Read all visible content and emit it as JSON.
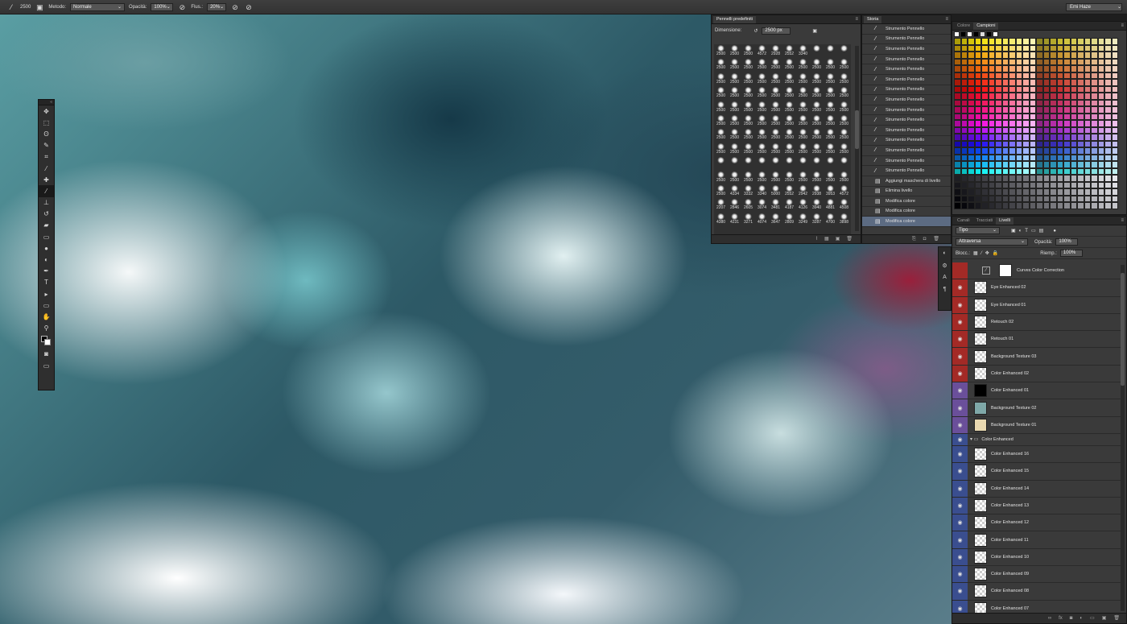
{
  "options_bar": {
    "brush_size": "2500",
    "mode_label": "Metodo:",
    "mode_value": "Normale",
    "opacity_label": "Opacità:",
    "opacity_value": "100%",
    "flow_label": "Flus.:",
    "flow_value": "20%",
    "workspace": "Emi Haze"
  },
  "toolbar": {
    "tools": [
      {
        "name": "move-tool",
        "glyph": "✥"
      },
      {
        "name": "marquee-tool",
        "glyph": "⬚"
      },
      {
        "name": "lasso-tool",
        "glyph": "ʘ"
      },
      {
        "name": "quick-select-tool",
        "glyph": "✎"
      },
      {
        "name": "crop-tool",
        "glyph": "⌗"
      },
      {
        "name": "eyedropper-tool",
        "glyph": "⁄"
      },
      {
        "name": "healing-brush-tool",
        "glyph": "✚"
      },
      {
        "name": "brush-tool",
        "glyph": "⁄"
      },
      {
        "name": "clone-stamp-tool",
        "glyph": "⊥"
      },
      {
        "name": "history-brush-tool",
        "glyph": "↺"
      },
      {
        "name": "eraser-tool",
        "glyph": "▰"
      },
      {
        "name": "gradient-tool",
        "glyph": "▭"
      },
      {
        "name": "blur-tool",
        "glyph": "●"
      },
      {
        "name": "dodge-tool",
        "glyph": "◐"
      },
      {
        "name": "pen-tool",
        "glyph": "✒"
      },
      {
        "name": "type-tool",
        "glyph": "T"
      },
      {
        "name": "path-select-tool",
        "glyph": "▸"
      },
      {
        "name": "shape-tool",
        "glyph": "▭"
      },
      {
        "name": "hand-tool",
        "glyph": "✋"
      },
      {
        "name": "zoom-tool",
        "glyph": "⚲"
      }
    ]
  },
  "brushes_panel": {
    "title": "Pennelli predefiniti",
    "dimension_label": "Dimensione:",
    "dimension_value": "2500 px",
    "sizes": [
      "2500",
      "2500",
      "2500",
      "4572",
      "2928",
      "2552",
      "3340",
      "",
      "",
      "",
      "2500",
      "2500",
      "2500",
      "2500",
      "2500",
      "2500",
      "2500",
      "2500",
      "2500",
      "2500",
      "2500",
      "2500",
      "2500",
      "2500",
      "2500",
      "2500",
      "2500",
      "2500",
      "2500",
      "2500",
      "2500",
      "2500",
      "2500",
      "2500",
      "2500",
      "2500",
      "2500",
      "2500",
      "2500",
      "2500",
      "2500",
      "2500",
      "2500",
      "2500",
      "2500",
      "2500",
      "2500",
      "2500",
      "2500",
      "2500",
      "2500",
      "2500",
      "2500",
      "2500",
      "2500",
      "2500",
      "2500",
      "2500",
      "2500",
      "2500",
      "2500",
      "2500",
      "2500",
      "2500",
      "2500",
      "2500",
      "2500",
      "2500",
      "2500",
      "2500",
      "2500",
      "2500",
      "2500",
      "2500",
      "2500",
      "2500",
      "2500",
      "2500",
      "2500",
      "2500",
      "",
      "",
      "",
      "",
      "",
      "",
      "",
      "",
      "",
      "",
      "2500",
      "2500",
      "2500",
      "2500",
      "2500",
      "2500",
      "2500",
      "2500",
      "2500",
      "2500",
      "2500",
      "4334",
      "3332",
      "3340",
      "5000",
      "2552",
      "2942",
      "2938",
      "3953",
      "4572",
      "2207",
      "2846",
      "2605",
      "3074",
      "3481",
      "4187",
      "4126",
      "3940",
      "4881",
      "4508",
      "4380",
      "4231",
      "3271",
      "4074",
      "3647",
      "2809",
      "3249",
      "3287",
      "4700",
      "3898"
    ]
  },
  "history_panel": {
    "title": "Storia",
    "items": [
      {
        "label": "Strumento Pennello",
        "icon": "brush-icon"
      },
      {
        "label": "Strumento Pennello",
        "icon": "brush-icon"
      },
      {
        "label": "Strumento Pennello",
        "icon": "brush-icon"
      },
      {
        "label": "Strumento Pennello",
        "icon": "brush-icon"
      },
      {
        "label": "Strumento Pennello",
        "icon": "brush-icon"
      },
      {
        "label": "Strumento Pennello",
        "icon": "brush-icon"
      },
      {
        "label": "Strumento Pennello",
        "icon": "brush-icon"
      },
      {
        "label": "Strumento Pennello",
        "icon": "brush-icon"
      },
      {
        "label": "Strumento Pennello",
        "icon": "brush-icon"
      },
      {
        "label": "Strumento Pennello",
        "icon": "brush-icon"
      },
      {
        "label": "Strumento Pennello",
        "icon": "brush-icon"
      },
      {
        "label": "Strumento Pennello",
        "icon": "brush-icon"
      },
      {
        "label": "Strumento Pennello",
        "icon": "brush-icon"
      },
      {
        "label": "Strumento Pennello",
        "icon": "brush-icon"
      },
      {
        "label": "Strumento Pennello",
        "icon": "brush-icon"
      },
      {
        "label": "Aggiungi maschera di livello",
        "icon": "document-icon"
      },
      {
        "label": "Elimina livello",
        "icon": "document-icon"
      },
      {
        "label": "Modifica colore",
        "icon": "document-icon"
      },
      {
        "label": "Modifica colore",
        "icon": "document-icon"
      },
      {
        "label": "Modifica colore",
        "icon": "document-icon",
        "selected": true
      }
    ]
  },
  "swatches_panel": {
    "tabs": [
      "Colore",
      "Campioni"
    ],
    "active_tab": "Campioni"
  },
  "layers_panel": {
    "tabs": [
      "Canali",
      "Tracciati",
      "Livelli"
    ],
    "active_tab": "Livelli",
    "filter_value": "Tipo",
    "blend_mode": "Attraversa",
    "opacity_label": "Opacità:",
    "opacity_value": "100%",
    "lock_label": "Blocc.:",
    "fill_label": "Riemp.:",
    "fill_value": "100%",
    "layers": [
      {
        "name": "Curves Color Correction",
        "color": "red",
        "type": "adjustment"
      },
      {
        "name": "Eye Enhanced 02",
        "color": "red"
      },
      {
        "name": "Eye Enhanced 01",
        "color": "red"
      },
      {
        "name": "Retouch 02",
        "color": "red"
      },
      {
        "name": "Retouch 01",
        "color": "red"
      },
      {
        "name": "Background Texture 03",
        "color": "red"
      },
      {
        "name": "Color Enhanced 02",
        "color": "red"
      },
      {
        "name": "Color Enhanced 01",
        "color": "purple",
        "thumb": "#000000"
      },
      {
        "name": "Background Texture 02",
        "color": "purple",
        "thumb": "#7fa8a8"
      },
      {
        "name": "Background Texture 01",
        "color": "purple",
        "thumb": "#e8d8b0"
      },
      {
        "name": "Color Enhanced",
        "color": "blue",
        "type": "group"
      },
      {
        "name": "Color Enhanced 16",
        "color": "blue"
      },
      {
        "name": "Color Enhanced 15",
        "color": "blue"
      },
      {
        "name": "Color Enhanced 14",
        "color": "blue"
      },
      {
        "name": "Color Enhanced 13",
        "color": "blue"
      },
      {
        "name": "Color Enhanced 12",
        "color": "blue"
      },
      {
        "name": "Color Enhanced 11",
        "color": "blue"
      },
      {
        "name": "Color Enhanced 10",
        "color": "blue"
      },
      {
        "name": "Color Enhanced 09",
        "color": "blue"
      },
      {
        "name": "Color Enhanced 08",
        "color": "blue"
      },
      {
        "name": "Color Enhanced 07",
        "color": "blue"
      }
    ]
  },
  "colors": {
    "label_red": "#a32a26",
    "label_purple": "#6a4f9a",
    "label_blue": "#3a4e8f",
    "selection": "#5c6b82"
  }
}
